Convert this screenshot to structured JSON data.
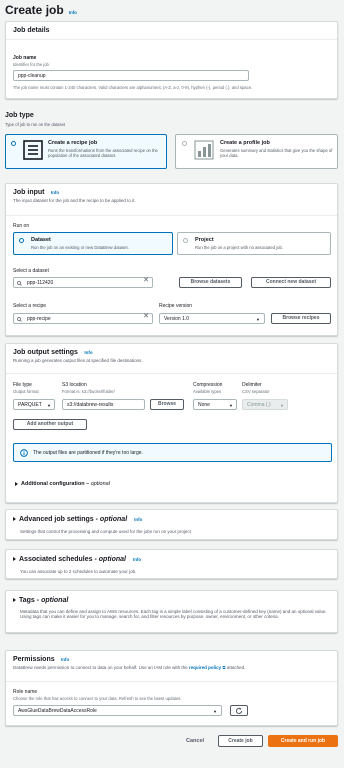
{
  "header": {
    "title": "Create job",
    "info": "Info"
  },
  "job_details": {
    "title": "Job details",
    "name_label": "Job name",
    "name_desc": "Identifier for the job",
    "name_value": "ppp-cleanup",
    "name_hint": "The job name must contain 1-240 characters. Valid characters are alphanumeric (A-Z, a-z, 0-9), hyphen (-), period (.), and space."
  },
  "job_type": {
    "title": "Job type",
    "desc": "Type of job to run on the dataset",
    "recipe_title": "Create a recipe job",
    "recipe_desc": "Runs the transformations from the associated recipe on the population of the associated dataset.",
    "profile_title": "Create a profile job",
    "profile_desc": "Generates summary and statistics that give you the shape of your data."
  },
  "job_input": {
    "title": "Job input",
    "info": "Info",
    "desc": "The input dataset for the job and the recipe to be applied to it.",
    "run_on": "Run on",
    "dataset_title": "Dataset",
    "dataset_desc": "Run the job on an existing or new DataBrew dataset.",
    "project_title": "Project",
    "project_desc": "Run the job on a project with no associated job.",
    "select_dataset": "Select a dataset",
    "dataset_value": "ppp-112420",
    "browse_datasets": "Browse datasets",
    "connect_dataset": "Connect new dataset",
    "select_recipe": "Select a recipe",
    "recipe_value": "ppp-recipe",
    "recipe_version_label": "Recipe version",
    "recipe_version_value": "Version 1.0",
    "browse_recipes": "Browse recipes"
  },
  "output": {
    "title": "Job output settings",
    "info": "Info",
    "desc": "Running a job generates output files at specified file destinations.",
    "file_type_label": "File type",
    "file_type_desc": "Output format",
    "file_type_value": "PARQUET",
    "s3_label": "S3 location",
    "s3_desc": "Format is: s3://bucket/folder/",
    "s3_value": "s3://databrew-results",
    "browse": "Browse",
    "compression_label": "Compression",
    "compression_desc": "Available types",
    "compression_value": "None",
    "delimiter_label": "Delimiter",
    "delimiter_desc": "CSV separator",
    "delimiter_value": "Comma (,)",
    "add_output": "Add another output",
    "alert": "The output files are partitioned if they're too large.",
    "additional_config": "Additional configuration",
    "optional": "optional"
  },
  "advanced": {
    "title": "Advanced job settings",
    "optional": "optional",
    "info": "Info",
    "desc": "Settings that control the processing and compute used for the jobs run on your project"
  },
  "schedules": {
    "title": "Associated schedules",
    "optional": "optional",
    "info": "Info",
    "desc": "You can associate up to 2 schedules to automate your job."
  },
  "tags": {
    "title": "Tags",
    "optional": "optional",
    "desc": "Metadata that you can define and assign to AWS resources. Each tag is a simple label consisting of a customer-defined key (name) and an optional value. Using tags can make it easier for you to manage, search for, and filter resources by purpose, owner, environment, or other criteria."
  },
  "permissions": {
    "title": "Permissions",
    "info": "Info",
    "desc_pre": "DataBrew needs permission to connect to data on your behalf. Use an IAM role with the",
    "desc_link": "required policy",
    "desc_post": "attached.",
    "role_label": "Role name",
    "role_desc": "Choose the role that has access to connect to your data. Refresh to see the latest updates.",
    "role_value": "AwsGlueDataBrewDataAccessRole"
  },
  "footer": {
    "cancel": "Cancel",
    "create": "Create job",
    "create_run": "Create and run job"
  },
  "colors": {
    "accent": "#0073bb",
    "primary": "#ec7211"
  }
}
